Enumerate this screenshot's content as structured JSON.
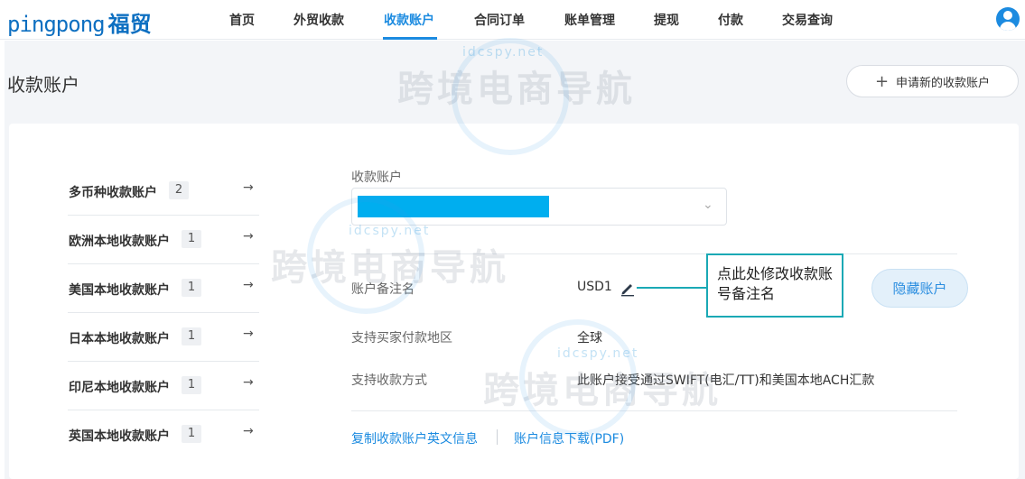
{
  "brand": {
    "logo_en": "pingpong",
    "logo_cn": "福贸"
  },
  "nav": {
    "items": [
      {
        "label": "首页"
      },
      {
        "label": "外贸收款"
      },
      {
        "label": "收款账户",
        "active": true
      },
      {
        "label": "合同订单"
      },
      {
        "label": "账单管理"
      },
      {
        "label": "提现"
      },
      {
        "label": "付款"
      },
      {
        "label": "交易查询"
      }
    ],
    "avatar_icon": "user-avatar-icon"
  },
  "page": {
    "title": "收款账户",
    "apply_button": {
      "plus": "+",
      "label": "申请新的收款账户"
    }
  },
  "accounts": [
    {
      "label": "多币种收款账户",
      "count": "2",
      "arrow": "→"
    },
    {
      "label": "欧洲本地收款账户",
      "count": "1",
      "arrow": "→"
    },
    {
      "label": "美国本地收款账户",
      "count": "1",
      "arrow": "→"
    },
    {
      "label": "日本本地收款账户",
      "count": "1",
      "arrow": "→"
    },
    {
      "label": "印尼本地收款账户",
      "count": "1",
      "arrow": "→"
    },
    {
      "label": "英国本地收款账户",
      "count": "1",
      "arrow": "→"
    }
  ],
  "detail": {
    "select_label": "收款账户",
    "select_chevron": "⌄",
    "remark_label": "账户备注名",
    "remark_value": "USD1",
    "region_label": "支持买家付款地区",
    "region_value": "全球",
    "method_label": "支持收款方式",
    "method_value": "此账户接受通过SWIFT(电汇/TT)和美国本地ACH汇款",
    "callout_text": "点此处修改收款账号备注名",
    "hide_button": "隐藏账户",
    "link_copy": "复制收款账户英文信息",
    "link_download": "账户信息下载(PDF)"
  },
  "watermark": {
    "text": "跨境电商导航",
    "site": "idcspy.net"
  },
  "colors": {
    "accent": "#1c8be0",
    "mask": "#00aeef",
    "callout": "#1aa9b5"
  }
}
